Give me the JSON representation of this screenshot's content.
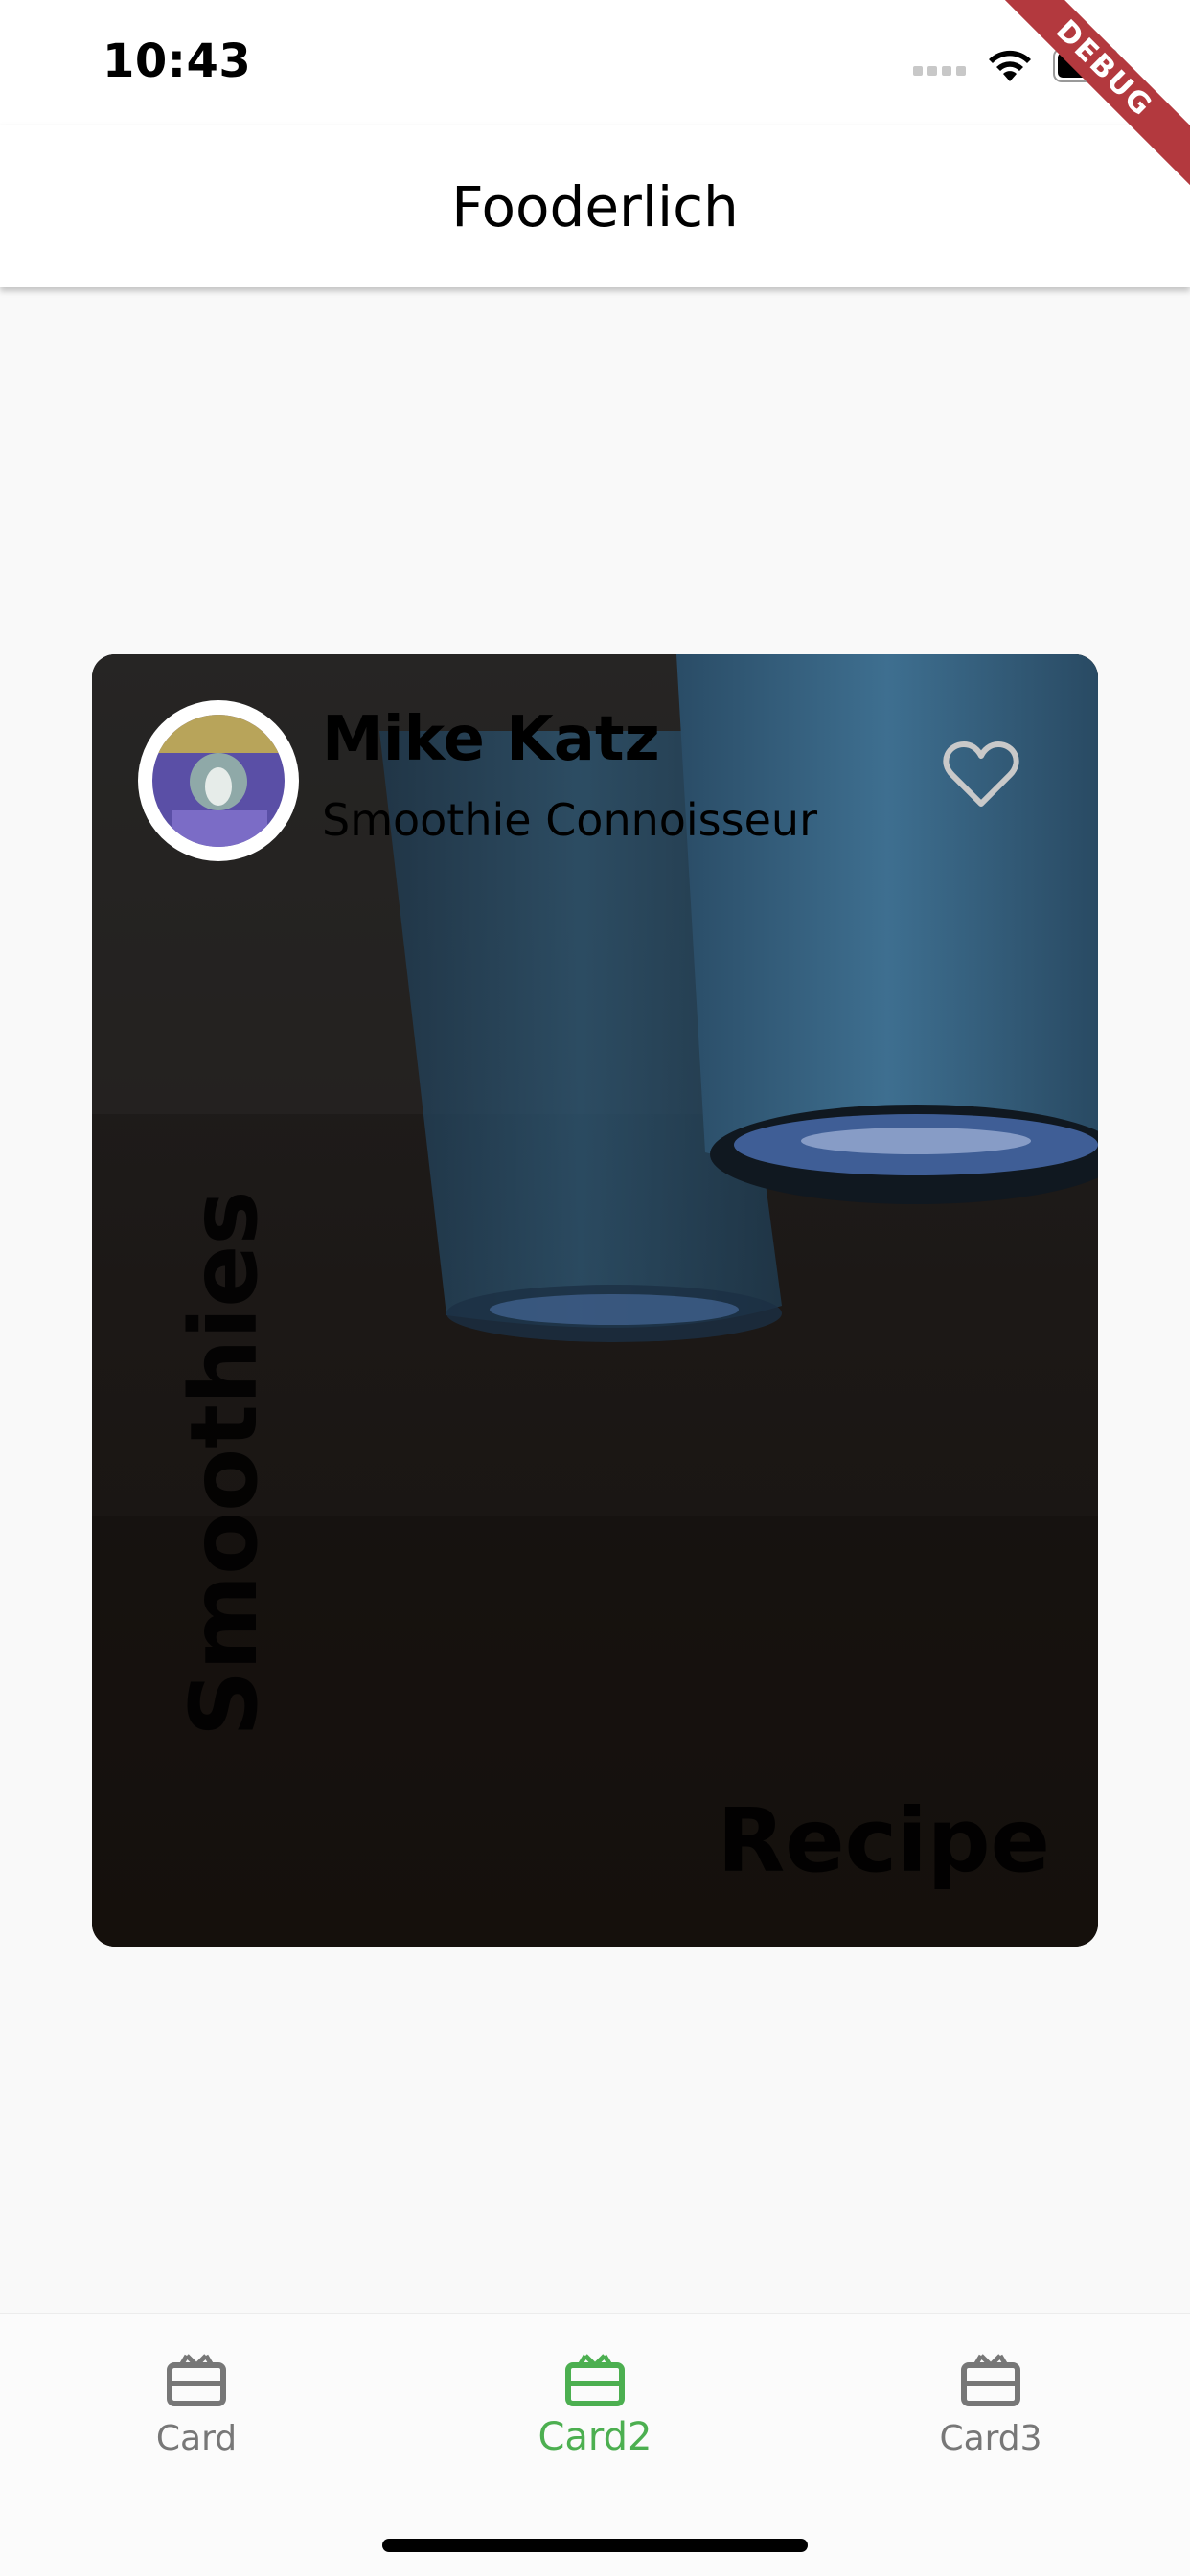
{
  "status_bar": {
    "time": "10:43"
  },
  "debug_banner": {
    "label": "DEBUG"
  },
  "app_bar": {
    "title": "Fooderlich"
  },
  "card": {
    "author": {
      "name": "Mike Katz",
      "title": "Smoothie Connoisseur"
    },
    "category": "Smoothies",
    "type_label": "Recipe",
    "favorite_icon": "heart-outline-icon"
  },
  "bottom_nav": {
    "active_color": "#4caf50",
    "inactive_color": "#777777",
    "items": [
      {
        "label": "Card",
        "icon": "card-giftcard-icon",
        "active": false
      },
      {
        "label": "Card2",
        "icon": "card-giftcard-icon",
        "active": true
      },
      {
        "label": "Card3",
        "icon": "card-giftcard-icon",
        "active": false
      }
    ]
  }
}
